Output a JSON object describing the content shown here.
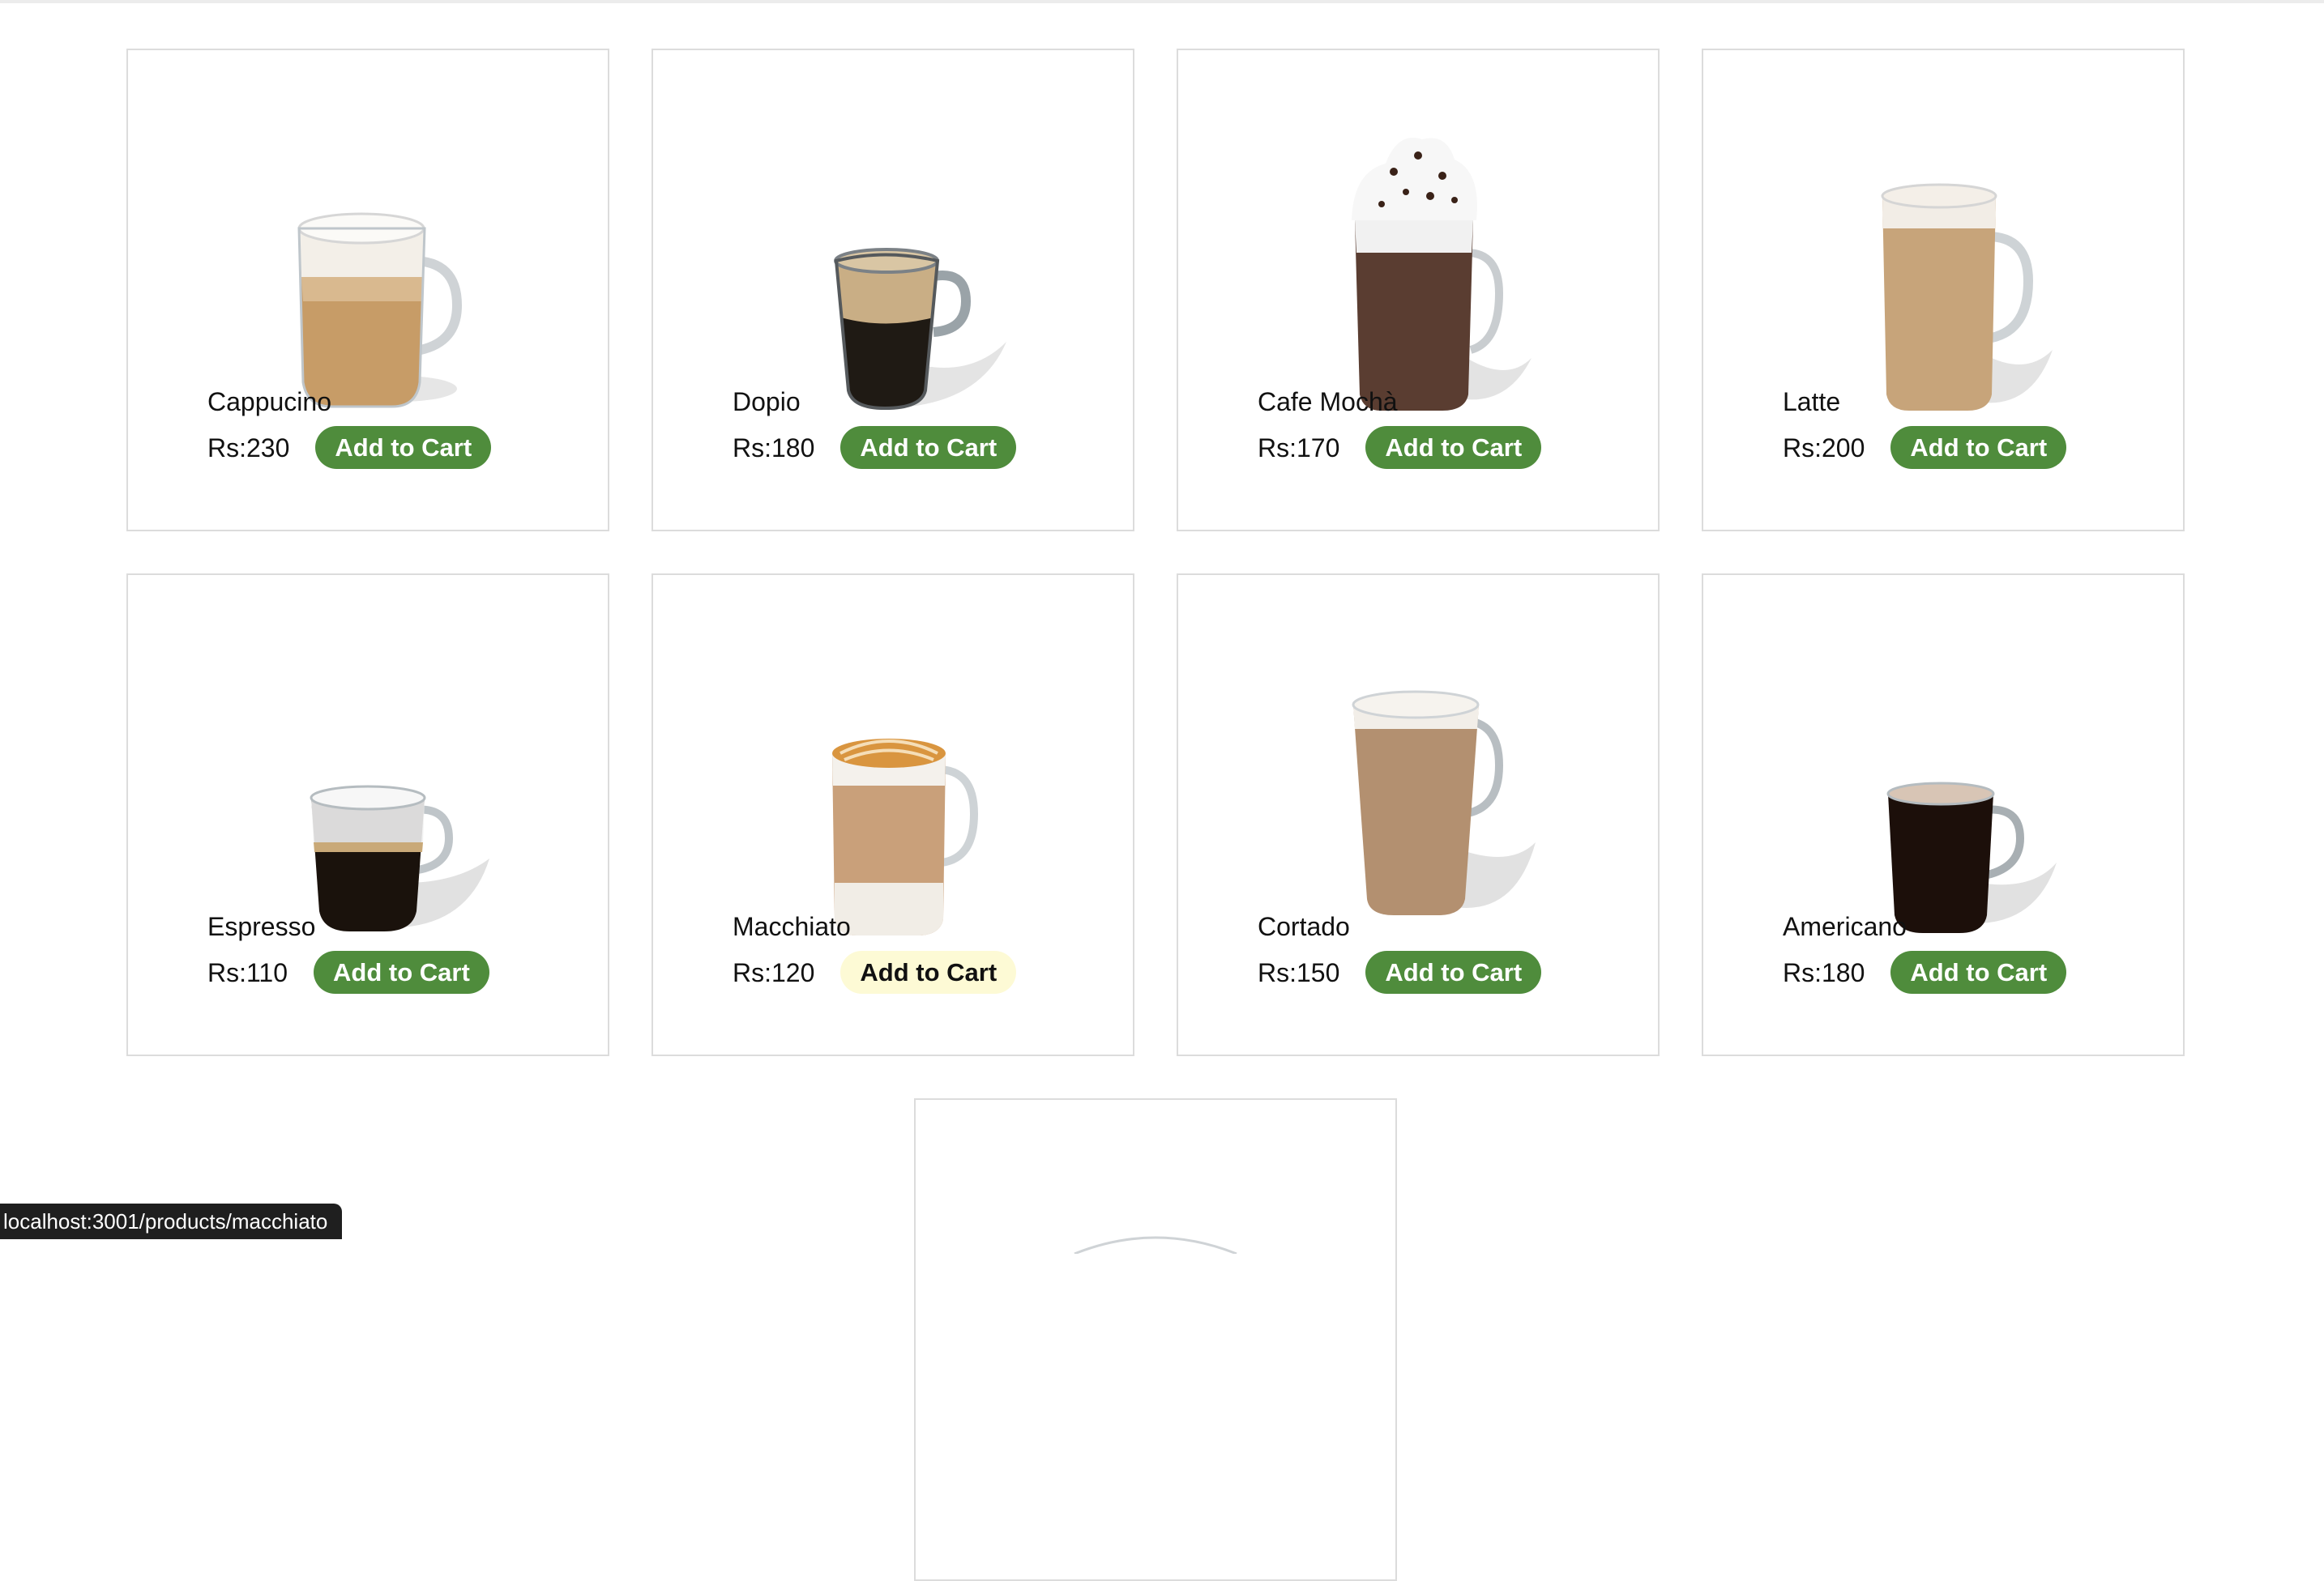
{
  "products": [
    {
      "name": "Cappucino",
      "price": "Rs:230",
      "button": "Add to Cart",
      "icon": "cappuccino-glass-mug-icon"
    },
    {
      "name": "Dopio",
      "price": "Rs:180",
      "button": "Add to Cart",
      "icon": "doppio-glass-cup-icon"
    },
    {
      "name": "Cafe Mochà",
      "price": "Rs:170",
      "button": "Add to Cart",
      "icon": "mocha-whipped-cream-mug-icon"
    },
    {
      "name": "Latte",
      "price": "Rs:200",
      "button": "Add to Cart",
      "icon": "latte-tall-mug-icon"
    },
    {
      "name": "Espresso",
      "price": "Rs:110",
      "button": "Add to Cart",
      "icon": "espresso-glass-cup-icon"
    },
    {
      "name": "Macchiato",
      "price": "Rs:120",
      "button": "Add to Cart",
      "icon": "macchiato-caramel-mug-icon"
    },
    {
      "name": "Cortado",
      "price": "Rs:150",
      "button": "Add to Cart",
      "icon": "cortado-glass-mug-icon"
    },
    {
      "name": "Americano",
      "price": "Rs:180",
      "button": "Add to Cart",
      "icon": "americano-glass-mug-icon"
    }
  ],
  "hovered_button": "Macchiato",
  "status_bar": {
    "url": "localhost:3001/products/macchiato"
  },
  "colors": {
    "button_bg": "#4f8c3c",
    "button_hover_bg": "#fdfad5",
    "card_border": "#dcdcdc"
  }
}
